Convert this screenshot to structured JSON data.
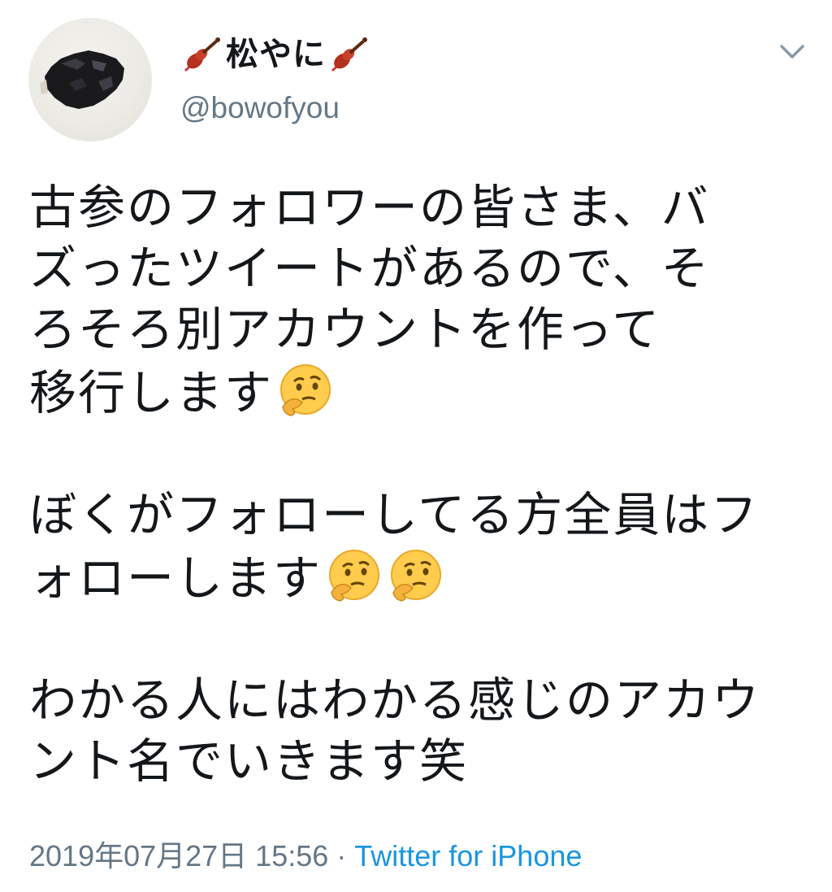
{
  "tweet": {
    "author": {
      "display_name": "松やに",
      "handle": "@bowofyou",
      "name_emoji_icon": "violin-icon"
    },
    "menu_icon": "chevron-down-icon",
    "body": {
      "paragraph1": [
        "古参のフォロワーの皆さま、バ",
        "ズったツイートがあるので、そ",
        "ろそろ別アカウントを作って",
        "移行します"
      ],
      "paragraph2": [
        "ぼくがフォローしてる方全員はフ",
        "ォローします"
      ],
      "paragraph3": [
        "わかる人にはわかる感じのアカウ",
        "ント名でいきます笑"
      ],
      "emoji_icon": "thinking-face-icon"
    },
    "timestamp": "2019年07月27日 15:56",
    "separator": "·",
    "source": "Twitter for iPhone"
  },
  "colors": {
    "text": "#14171a",
    "secondary_text": "#657786",
    "link": "#1b95e0"
  }
}
